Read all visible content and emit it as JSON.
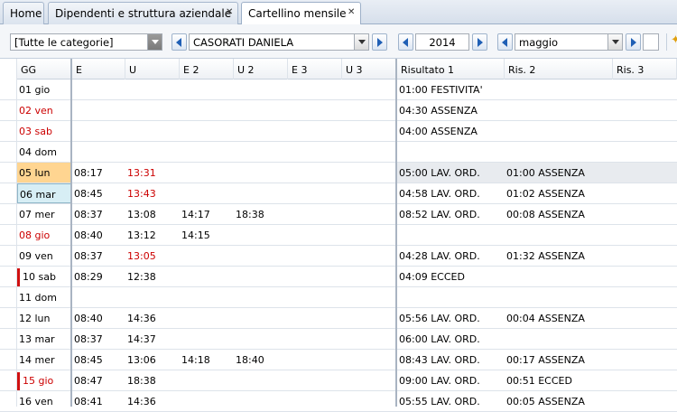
{
  "tabs": [
    {
      "label": "Home",
      "closable": false,
      "active": false
    },
    {
      "label": "Dipendenti e struttura aziendale",
      "closable": true,
      "active": false
    },
    {
      "label": "Cartellino mensile",
      "closable": true,
      "active": true
    }
  ],
  "toolbar": {
    "category": "[Tutte le categorie]",
    "employee": "CASORATI DANIELA",
    "year": "2014",
    "month": "maggio",
    "icons": [
      "prev-icon",
      "next-icon",
      "dropdown-icon",
      "wand-icon"
    ]
  },
  "columns": {
    "gg": "GG",
    "e1": "E",
    "u1": "U",
    "e2": "E 2",
    "u2": "U 2",
    "e3": "E 3",
    "u3": "U 3",
    "r1": "Risultato 1",
    "r2": "Ris. 2",
    "r3": "Ris. 3"
  },
  "colors": {
    "holiday_text": "#cc0000",
    "today_highlight": "#ffd591",
    "selected_day": "#d7eef5",
    "marker": "#d01010",
    "alt_row": "#e8ebef"
  },
  "rows": [
    {
      "gg": "01 gio",
      "gg_red": false,
      "e1": "",
      "u1": "",
      "e2": "",
      "u2": "",
      "r1": "01:00 FESTIVITA'",
      "r2": ""
    },
    {
      "gg": "02 ven",
      "gg_red": true,
      "e1": "",
      "u1": "",
      "e2": "",
      "u2": "",
      "r1": "04:30 ASSENZA",
      "r2": ""
    },
    {
      "gg": "03 sab",
      "gg_red": true,
      "e1": "",
      "u1": "",
      "e2": "",
      "u2": "",
      "r1": "04:00 ASSENZA",
      "r2": ""
    },
    {
      "gg": "04 dom",
      "gg_red": false,
      "e1": "",
      "u1": "",
      "e2": "",
      "u2": "",
      "r1": "",
      "r2": ""
    },
    {
      "gg": "05 lun",
      "gg_red": false,
      "hl": "today",
      "alt": true,
      "e1": "08:17",
      "u1": "13:31",
      "u1_red": true,
      "e2": "",
      "u2": "",
      "r1": "05:00 LAV. ORD.",
      "r2": "01:00 ASSENZA"
    },
    {
      "gg": "06 mar",
      "gg_red": false,
      "hl": "selected",
      "e1": "08:45",
      "u1": "13:43",
      "u1_red": true,
      "e2": "",
      "u2": "",
      "r1": "04:58 LAV. ORD.",
      "r2": "01:02 ASSENZA"
    },
    {
      "gg": "07 mer",
      "gg_red": false,
      "e1": "08:37",
      "u1": "13:08",
      "e2": "14:17",
      "u2": "18:38",
      "r1": "08:52 LAV. ORD.",
      "r2": "00:08 ASSENZA"
    },
    {
      "gg": "08 gio",
      "gg_red": true,
      "e1": "08:40",
      "u1": "13:12",
      "e2": "14:15",
      "u2": "",
      "r1": "",
      "r2": ""
    },
    {
      "gg": "09 ven",
      "gg_red": false,
      "e1": "08:37",
      "u1": "13:05",
      "u1_red": true,
      "e2": "",
      "u2": "",
      "r1": "04:28 LAV. ORD.",
      "r2": "01:32 ASSENZA"
    },
    {
      "gg": "10 sab",
      "gg_red": false,
      "marker": true,
      "e1": "08:29",
      "u1": "12:38",
      "e2": "",
      "u2": "",
      "r1": "04:09 ECCED",
      "r2": ""
    },
    {
      "gg": "11 dom",
      "gg_red": false,
      "e1": "",
      "u1": "",
      "e2": "",
      "u2": "",
      "r1": "",
      "r2": ""
    },
    {
      "gg": "12 lun",
      "gg_red": false,
      "e1": "08:40",
      "u1": "14:36",
      "e2": "",
      "u2": "",
      "r1": "05:56 LAV. ORD.",
      "r2": "00:04 ASSENZA"
    },
    {
      "gg": "13 mar",
      "gg_red": false,
      "e1": "08:37",
      "u1": "14:37",
      "e2": "",
      "u2": "",
      "r1": "06:00 LAV. ORD.",
      "r2": ""
    },
    {
      "gg": "14 mer",
      "gg_red": false,
      "e1": "08:45",
      "u1": "13:06",
      "e2": "14:18",
      "u2": "18:40",
      "r1": "08:43 LAV. ORD.",
      "r2": "00:17 ASSENZA"
    },
    {
      "gg": "15 gio",
      "gg_red": true,
      "marker": true,
      "e1": "08:47",
      "u1": "18:38",
      "e2": "",
      "u2": "",
      "r1": "09:00 LAV. ORD.",
      "r2": "00:51 ECCED"
    },
    {
      "gg": "16 ven",
      "gg_red": false,
      "e1": "08:41",
      "u1": "14:36",
      "e2": "",
      "u2": "",
      "r1": "05:55 LAV. ORD.",
      "r2": "00:05 ASSENZA"
    }
  ]
}
